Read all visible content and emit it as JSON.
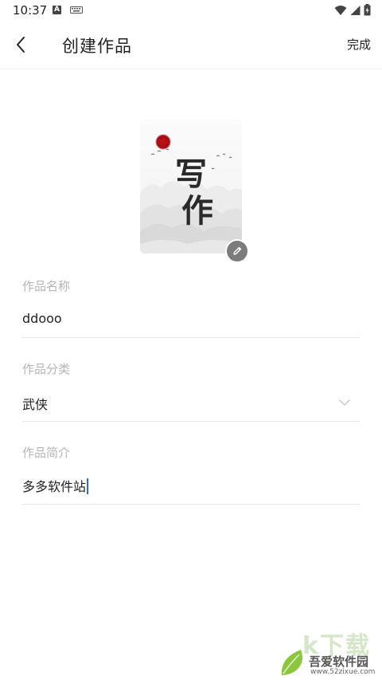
{
  "status_bar": {
    "time": "10:37",
    "notif_letter": "A"
  },
  "app_bar": {
    "title": "创建作品",
    "done_label": "完成"
  },
  "cover": {
    "title_text": "写作"
  },
  "form": {
    "name": {
      "label": "作品名称",
      "value": "ddooo"
    },
    "category": {
      "label": "作品分类",
      "value": "武侠"
    },
    "intro": {
      "label": "作品简介",
      "value": "多多软件站"
    }
  },
  "watermark": {
    "big_text": "k下载",
    "name": "吾爱软件园",
    "url": "www.52zixue.com"
  },
  "colors": {
    "caret": "#2b6fd6",
    "sun": "#c0121a",
    "edit_badge": "#7b7b7b"
  }
}
